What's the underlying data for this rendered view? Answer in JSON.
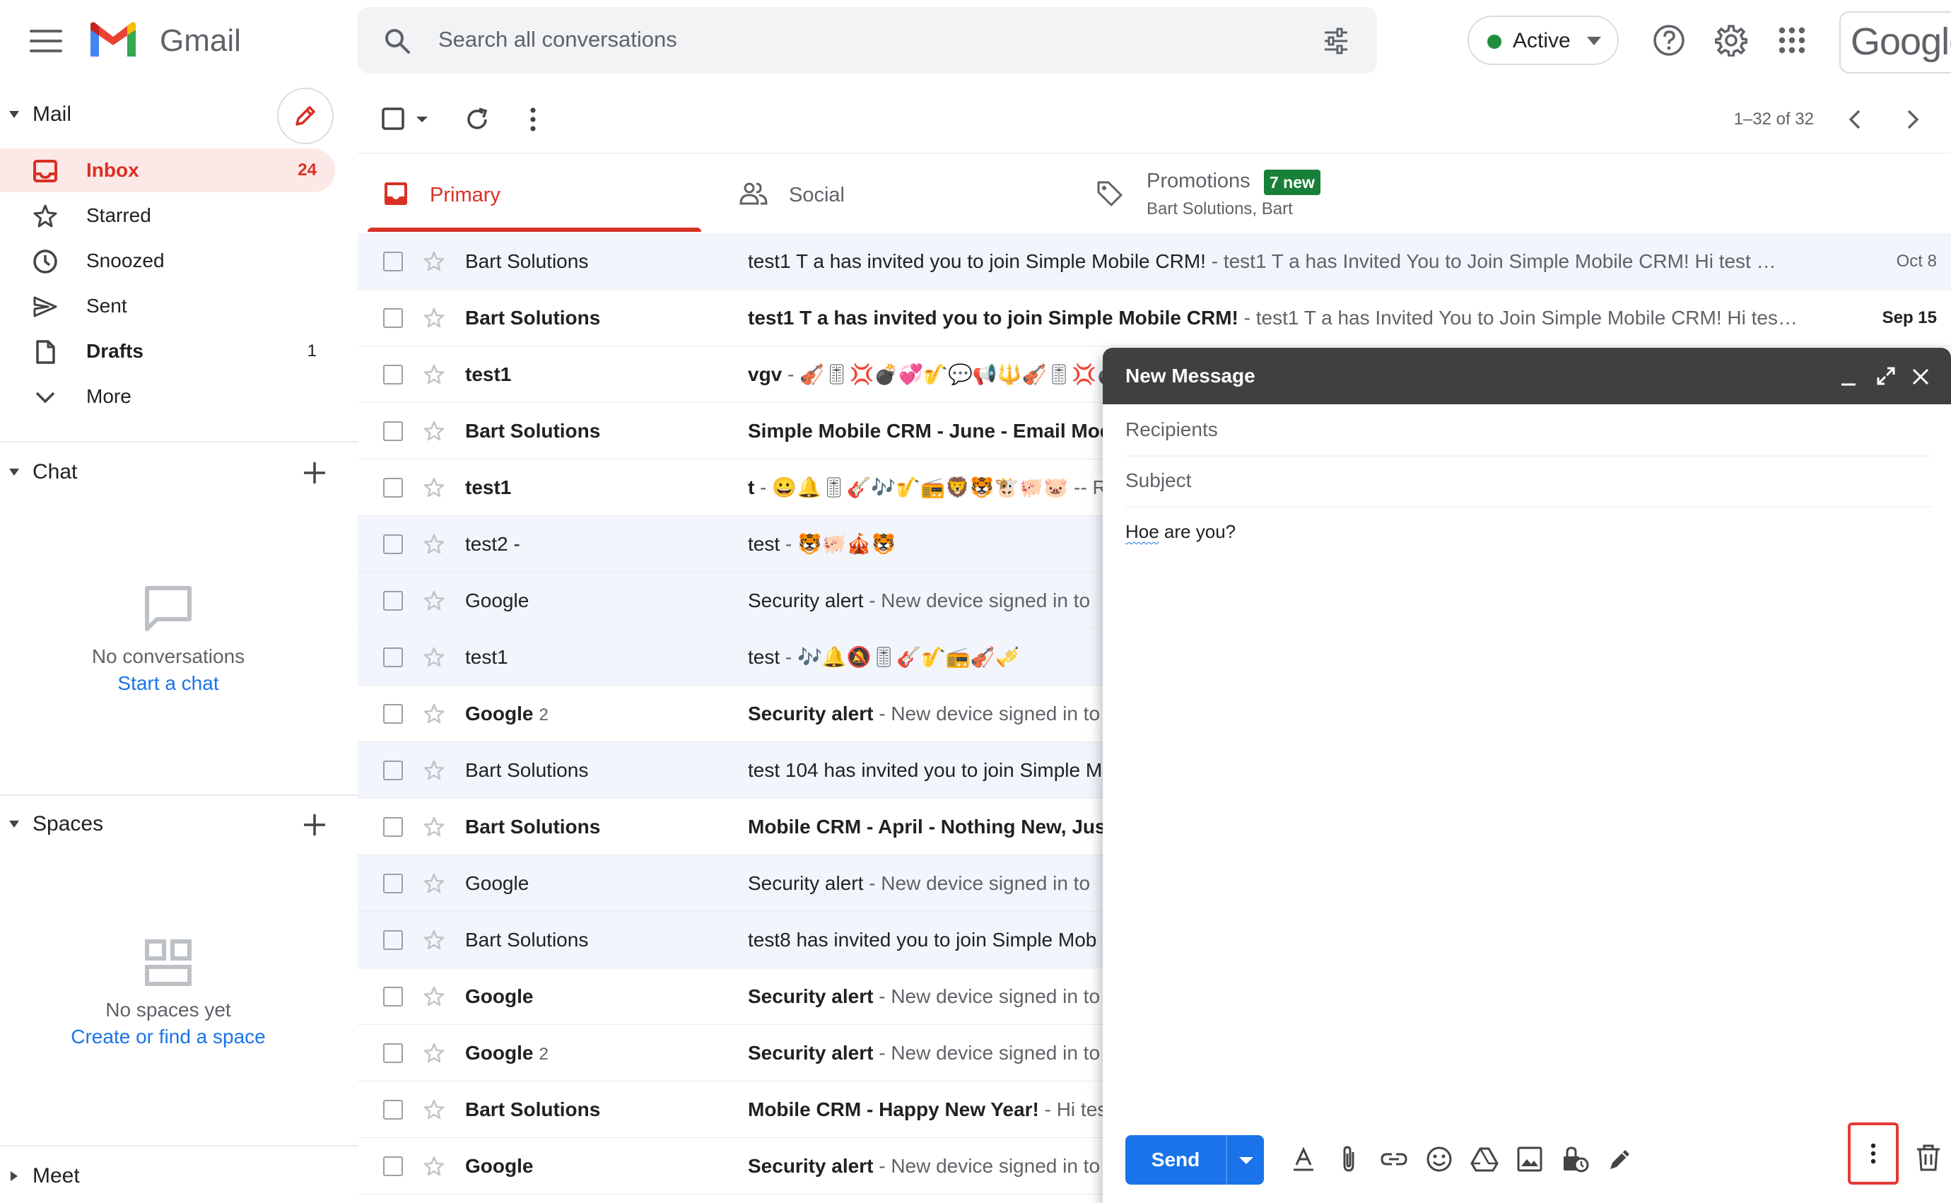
{
  "app": {
    "name": "Gmail"
  },
  "search": {
    "placeholder": "Search all conversations"
  },
  "status": {
    "label": "Active",
    "color": "#1e8e3e"
  },
  "account": {
    "logo_text": "Google"
  },
  "sidebar": {
    "mail_label": "Mail",
    "items": [
      {
        "label": "Inbox",
        "count": "24",
        "icon": "inbox-icon"
      },
      {
        "label": "Starred",
        "count": "",
        "icon": "star-icon"
      },
      {
        "label": "Snoozed",
        "count": "",
        "icon": "clock-icon"
      },
      {
        "label": "Sent",
        "count": "",
        "icon": "send-icon"
      },
      {
        "label": "Drafts",
        "count": "1",
        "icon": "draft-icon"
      },
      {
        "label": "More",
        "count": "",
        "icon": "chevron-down-icon"
      }
    ],
    "chat": {
      "label": "Chat",
      "empty": "No conversations",
      "link": "Start a chat"
    },
    "spaces": {
      "label": "Spaces",
      "empty": "No spaces yet",
      "link": "Create or find a space"
    },
    "meet": {
      "label": "Meet"
    }
  },
  "toolbar": {
    "pagination": "1–32 of 32"
  },
  "tabs": {
    "primary": "Primary",
    "social": "Social",
    "promotions": "Promotions",
    "promotions_badge": "7 new",
    "promotions_sub": "Bart Solutions, Bart"
  },
  "emails": [
    {
      "sender": "Bart Solutions",
      "count": "",
      "subject": "test1 T a has invited you to join Simple Mobile CRM!",
      "snippet": "test1 T a has Invited You to Join Simple Mobile CRM! Hi test …",
      "date": "Oct 8",
      "unread": false
    },
    {
      "sender": "Bart Solutions",
      "count": "",
      "subject": "test1 T a has invited you to join Simple Mobile CRM!",
      "snippet": "test1 T a has Invited You to Join Simple Mobile CRM! Hi tes…",
      "date": "Sep 15",
      "unread": true
    },
    {
      "sender": "test1",
      "count": "",
      "subject": "vgv",
      "snippet": "🎻🎚💢💣💞🎷💬📢🔱🎻🎚💢💣",
      "date": "",
      "unread": true
    },
    {
      "sender": "Bart Solutions",
      "count": "",
      "subject": "Simple Mobile CRM - June - Email Mod",
      "snippet": "",
      "date": "",
      "unread": true
    },
    {
      "sender": "test1",
      "count": "",
      "subject": "t",
      "snippet": "😀🔔🎚🎸🎶🎷📻🦁🐯🐮🐖🐷 -- Re",
      "date": "",
      "unread": true
    },
    {
      "sender": "test2 -",
      "count": "",
      "subject": "test",
      "snippet": "🐯🐖🎪🐯",
      "date": "",
      "unread": false
    },
    {
      "sender": "Google",
      "count": "",
      "subject": "Security alert",
      "snippet": "New device signed in to",
      "date": "",
      "unread": false
    },
    {
      "sender": "test1",
      "count": "",
      "subject": "test",
      "snippet": "🎶🔔🔕🎚🎸🎷📻🎻🎺",
      "date": "",
      "unread": false
    },
    {
      "sender": "Google",
      "count": "2",
      "subject": "Security alert",
      "snippet": "New device signed in to",
      "date": "",
      "unread": true
    },
    {
      "sender": "Bart Solutions",
      "count": "",
      "subject": "test 104 has invited you to join Simple M",
      "snippet": "",
      "date": "",
      "unread": false
    },
    {
      "sender": "Bart Solutions",
      "count": "",
      "subject": "Mobile CRM - April - Nothing New, Just",
      "snippet": "",
      "date": "",
      "unread": true
    },
    {
      "sender": "Google",
      "count": "",
      "subject": "Security alert",
      "snippet": "New device signed in to",
      "date": "",
      "unread": false
    },
    {
      "sender": "Bart Solutions",
      "count": "",
      "subject": "test8 has invited you to join Simple Mob",
      "snippet": "",
      "date": "",
      "unread": false
    },
    {
      "sender": "Google",
      "count": "",
      "subject": "Security alert",
      "snippet": "New device signed in to",
      "date": "",
      "unread": true
    },
    {
      "sender": "Google",
      "count": "2",
      "subject": "Security alert",
      "snippet": "New device signed in to",
      "date": "",
      "unread": true
    },
    {
      "sender": "Bart Solutions",
      "count": "",
      "subject": "Mobile CRM - Happy New Year!",
      "snippet": "Hi tes",
      "date": "",
      "unread": true
    },
    {
      "sender": "Google",
      "count": "",
      "subject": "Security alert",
      "snippet": "New device signed in to",
      "date": "",
      "unread": true
    }
  ],
  "compose": {
    "title": "New Message",
    "recipients_placeholder": "Recipients",
    "subject_placeholder": "Subject",
    "body_word1": "Hoe",
    "body_rest": " are you?",
    "send_label": "Send",
    "tools": [
      "format-text-icon",
      "attach-icon",
      "link-icon",
      "emoji-icon",
      "drive-icon",
      "photo-icon",
      "confidential-icon",
      "signature-icon"
    ]
  },
  "colors": {
    "accent": "#d93025",
    "link": "#1a73e8",
    "send": "#1a73e8",
    "compose_header": "#404040",
    "highlight": "#e53935"
  }
}
